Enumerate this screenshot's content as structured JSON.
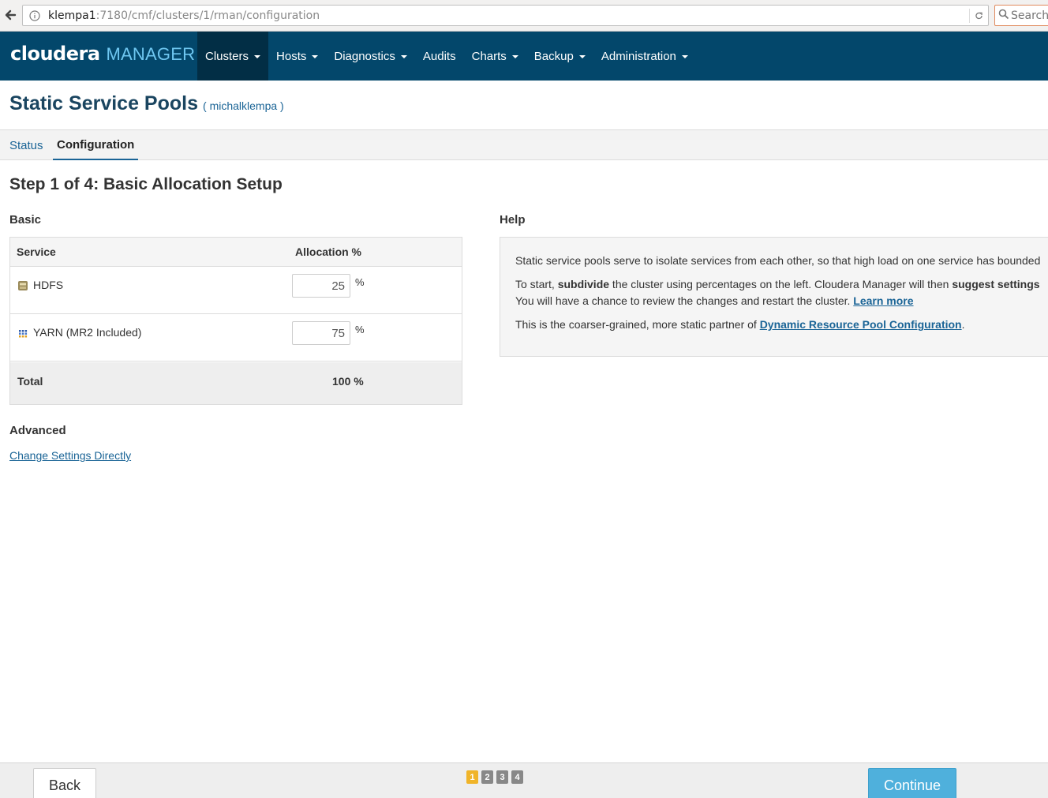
{
  "browser": {
    "url_host": "klempa1",
    "url_rest": ":7180/cmf/clusters/1/rman/configuration",
    "search_placeholder": "Search"
  },
  "navbar": {
    "logo_main": "cloudera",
    "logo_sub": "MANAGER",
    "items": [
      {
        "label": "Clusters",
        "dropdown": true,
        "active": true
      },
      {
        "label": "Hosts",
        "dropdown": true
      },
      {
        "label": "Diagnostics",
        "dropdown": true
      },
      {
        "label": "Audits",
        "dropdown": false
      },
      {
        "label": "Charts",
        "dropdown": true
      },
      {
        "label": "Backup",
        "dropdown": true
      },
      {
        "label": "Administration",
        "dropdown": true
      }
    ]
  },
  "page": {
    "title": "Static Service Pools",
    "cluster": "( michalklempa )"
  },
  "tabs": {
    "status": "Status",
    "configuration": "Configuration"
  },
  "step_title": "Step 1 of 4: Basic Allocation Setup",
  "basic": {
    "heading": "Basic",
    "col_service": "Service",
    "col_allocation": "Allocation %",
    "rows": [
      {
        "service": "HDFS",
        "icon": "hdfs-icon",
        "value": "25",
        "unit": "%"
      },
      {
        "service": "YARN (MR2 Included)",
        "icon": "yarn-icon",
        "value": "75",
        "unit": "%"
      }
    ],
    "total_label": "Total",
    "total_value": "100 %"
  },
  "advanced": {
    "heading": "Advanced",
    "link": "Change Settings Directly"
  },
  "help": {
    "heading": "Help",
    "p1": "Static service pools serve to isolate services from each other, so that high load on one service has bounded",
    "p2_a": "To start, ",
    "p2_b": "subdivide",
    "p2_c": " the cluster using percentages on the left. Cloudera Manager will then ",
    "p2_d": "suggest settings",
    "p3_a": "You will have a chance to review the changes and restart the cluster. ",
    "p3_link": "Learn more",
    "p4_a": "This is the coarser-grained, more static partner of ",
    "p4_link": "Dynamic Resource Pool Configuration",
    "p4_b": "."
  },
  "footer": {
    "back": "Back",
    "continue": "Continue",
    "steps": [
      "1",
      "2",
      "3",
      "4"
    ],
    "current_step": 1
  },
  "colors": {
    "navbar": "#03476b",
    "navbar_active": "#022e45",
    "link": "#1a6496",
    "continue": "#4fb0dc",
    "step_current": "#f0b429"
  }
}
